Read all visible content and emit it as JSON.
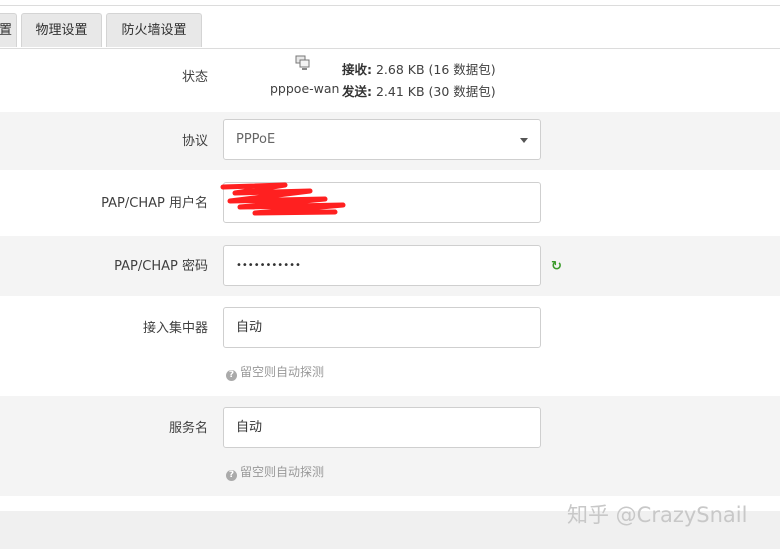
{
  "tabs": [
    {
      "label": "置"
    },
    {
      "label": "物理设置"
    },
    {
      "label": "防火墙设置"
    }
  ],
  "status": {
    "label": "状态",
    "icon": "network-icon",
    "interface": "pppoe-wan",
    "rx_label": "接收:",
    "rx_value": " 2.68 KB (16 数据包)",
    "tx_label": "发送:",
    "tx_value": " 2.41 KB (30 数据包)"
  },
  "protocol": {
    "label": "协议",
    "value": "PPPoE"
  },
  "username": {
    "label": "PAP/CHAP 用户名",
    "value": ""
  },
  "password": {
    "label": "PAP/CHAP 密码",
    "value": "•••••••••••"
  },
  "concentrator": {
    "label": "接入集中器",
    "placeholder": "自动",
    "hint": "留空则自动探测"
  },
  "service": {
    "label": "服务名",
    "placeholder": "自动",
    "hint": "留空则自动探测"
  },
  "watermark": "知乎 @CrazySnail",
  "colors": {
    "refresh_icon": "#3a9a2a",
    "redaction": "#ff2020"
  }
}
